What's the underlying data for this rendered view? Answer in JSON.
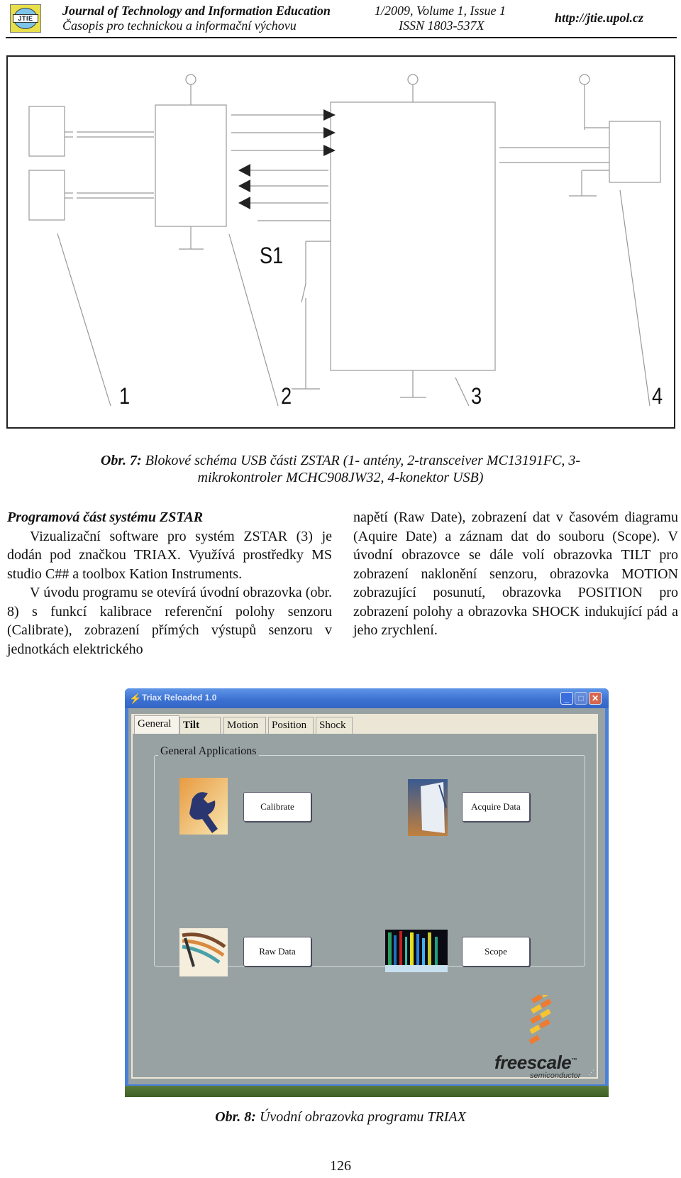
{
  "header": {
    "logo_text": "JTIE",
    "journal_title": "Journal of Technology and Information Education",
    "journal_subtitle": "Časopis pro technickou a informační výchovu",
    "issue": "1/2009, Volume 1, Issue 1",
    "issn": "ISSN 1803-537X",
    "url": "http://jtie.upol.cz"
  },
  "figure7": {
    "labels": [
      "1",
      "2",
      "3",
      "4"
    ],
    "switch_label": "S1",
    "caption_prefix": "Obr. 7:",
    "caption_line1": "Blokové schéma USB části ZSTAR (1- antény, 2-transceiver MC13191FC, 3-",
    "caption_line2": "mikrokontroler  MCHC908JW32, 4-konektor USB)"
  },
  "body": {
    "heading": "Programová část systému ZSTAR",
    "left_p1": "Vizualizační software pro systém ZSTAR (3) je dodán pod značkou TRIAX. Využívá prostředky MS studio C## a toolbox Kation Instruments.",
    "left_p2": "V úvodu programu se otevírá úvodní obrazovka (obr. 8) s funkcí kalibrace referenční polohy senzoru (Calibrate), zobrazení přímých výstupů senzoru v jednotkách elektrického",
    "right_p1": "napětí (Raw Date), zobrazení dat v časovém diagramu (Aquire Date) a záznam dat do souboru (Scope). V úvodní obrazovce se dále volí obrazovka TILT pro zobrazení naklonění senzoru, obrazovka MOTION zobrazující posunutí, obrazovka POSITION pro zobrazení polohy a obrazovka SHOCK indukující pád a jeho zrychlení."
  },
  "app": {
    "window_title": "Triax Reloaded 1.0",
    "tabs": [
      "General",
      "Tilt",
      "Motion",
      "Position",
      "Shock"
    ],
    "active_tab": "General",
    "group_title": "General Applications",
    "buttons": {
      "calibrate": "Calibrate",
      "acquire": "Acquire Data",
      "raw": "Raw Data",
      "scope": "Scope"
    },
    "brand": "freescale",
    "brand_tm": "™",
    "brand_sub": "semiconductor",
    "colors": {
      "titlebar": "#3a6fd0",
      "client": "#98a2a2",
      "tabstrip": "#ece6d6",
      "brand_orange": "#f07a30",
      "brand_yellow": "#f8c430"
    }
  },
  "figure8": {
    "caption_prefix": "Obr. 8:",
    "caption_text": "Úvodní obrazovka programu TRIAX"
  },
  "page_number": "126"
}
